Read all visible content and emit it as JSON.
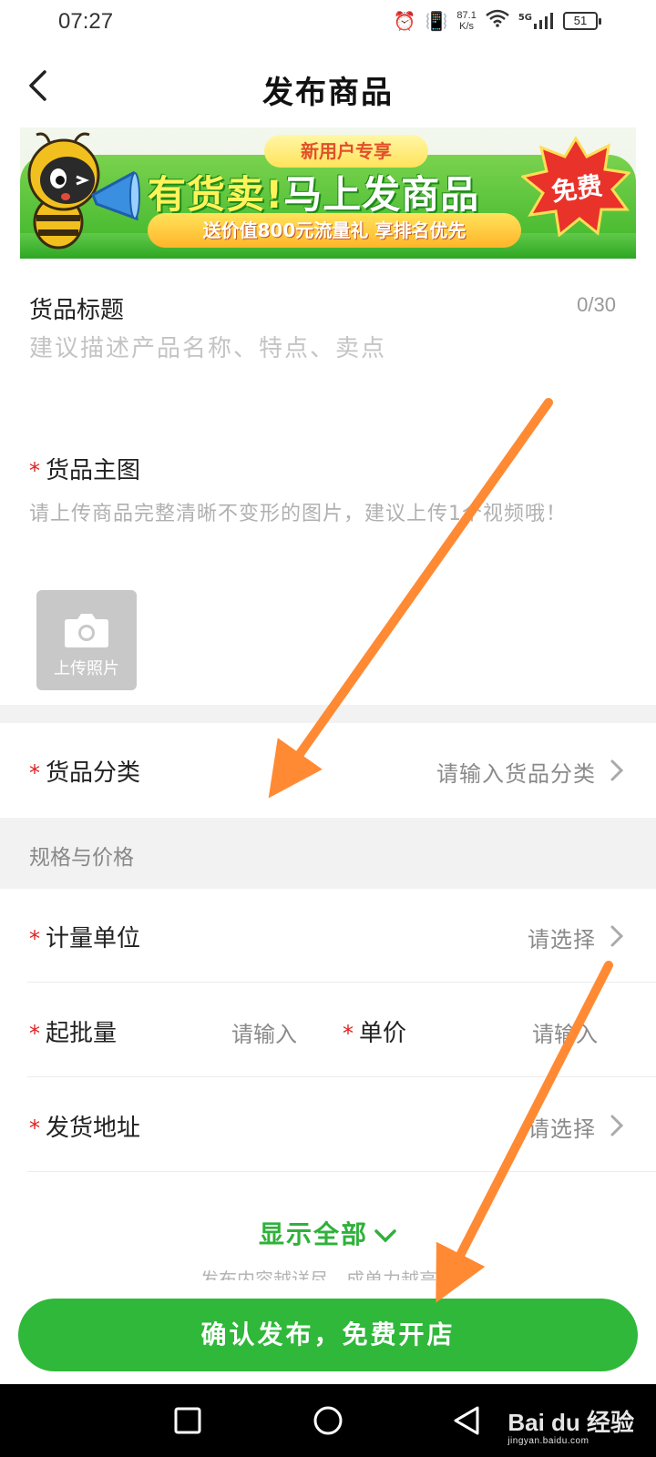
{
  "status": {
    "time": "07:27",
    "net_speed_value": "87.1",
    "net_speed_unit": "K/s",
    "signal": "5G",
    "battery": "51"
  },
  "header": {
    "title": "发布商品"
  },
  "banner": {
    "tag": "新用户专享",
    "headline_highlight": "有货卖!",
    "headline_rest": "马上发商品",
    "subline": "送价值800元流量礼 享排名优先",
    "badge": "免费"
  },
  "form": {
    "title_field": {
      "label": "货品标题",
      "counter": "0/30",
      "placeholder": "建议描述产品名称、特点、卖点",
      "value": ""
    },
    "main_image": {
      "required_mark": "*",
      "label": "货品主图",
      "description": "请上传商品完整清晰不变形的图片，建议上传1个视频哦！",
      "upload_label": "上传照片"
    },
    "category": {
      "required_mark": "*",
      "label": "货品分类",
      "placeholder": "请输入货品分类"
    },
    "spec_section_title": "规格与价格",
    "unit": {
      "required_mark": "*",
      "label": "计量单位",
      "placeholder": "请选择"
    },
    "min_order": {
      "required_mark": "*",
      "label": "起批量",
      "placeholder": "请输入"
    },
    "unit_price": {
      "required_mark": "*",
      "label": "单价",
      "placeholder": "请输入"
    },
    "ship_address": {
      "required_mark": "*",
      "label": "发货地址",
      "placeholder": "请选择"
    },
    "show_all": "显示全部",
    "footer_note": "发布内容越详尽，成单力越高哦"
  },
  "actions": {
    "confirm": "确认发布，免费开店"
  },
  "watermark": {
    "brand": "Bai du 经验",
    "url": "jingyan.baidu.com"
  },
  "colors": {
    "accent_green": "#2fb83a",
    "required_red": "#e02020",
    "annotation_orange": "#ff8a33"
  }
}
